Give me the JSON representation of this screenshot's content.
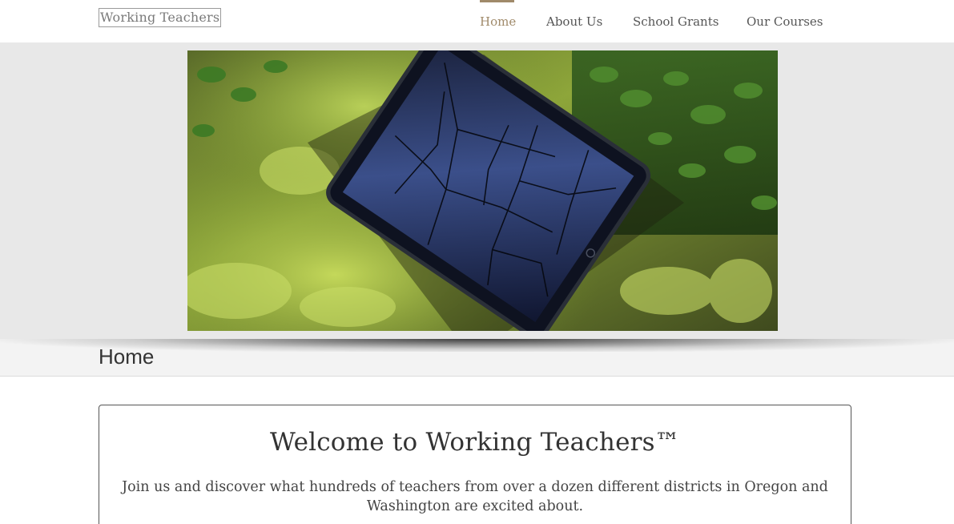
{
  "header": {
    "logo_text": "Working Teachers",
    "nav": {
      "home": "Home",
      "about": "About Us",
      "grants": "School Grants",
      "courses": "Our Courses"
    },
    "active_item": "Home"
  },
  "hero": {
    "image_icon": "tablet-on-moss-photo"
  },
  "page": {
    "title": "Home"
  },
  "content": {
    "heading": "Welcome to Working Teachers™",
    "intro": "Join us and discover what hundreds of teachers from over a dozen different districts in Oregon and Washington are excited about."
  },
  "colors": {
    "accent": "#a08a6a",
    "hero_background": "#e8e8e8",
    "text": "#333333"
  }
}
